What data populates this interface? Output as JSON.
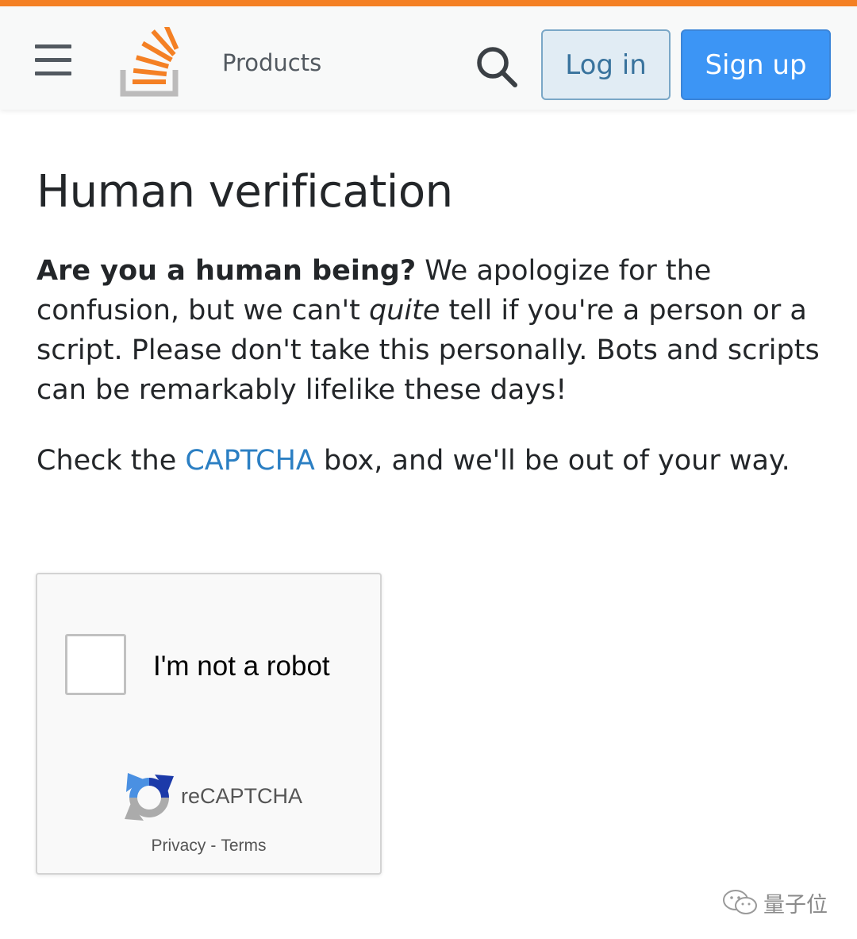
{
  "colors": {
    "accent": "#f48024",
    "login_bg": "#e1ecf4",
    "signup_bg": "#3c95f5",
    "link": "#2b7fc3"
  },
  "header": {
    "menu_icon": "hamburger-menu-icon",
    "logo": "stack-overflow-logo",
    "products_label": "Products",
    "search_icon": "search-icon",
    "login_label": "Log in",
    "signup_label": "Sign up"
  },
  "main": {
    "title": "Human verification",
    "intro_bold": "Are you a human being?",
    "intro_text_1": " We apologize for the confusion, but we can't ",
    "intro_italic": "quite",
    "intro_text_2": " tell if you're a person or a script. Please don't take this personally. Bots and scripts can be remarkably lifelike these days!",
    "check_text_1": "Check the ",
    "check_link": "CAPTCHA",
    "check_text_2": " box, and we'll be out of your way."
  },
  "recaptcha": {
    "checkbox_label": "I'm not a robot",
    "brand": "reCAPTCHA",
    "privacy_label": "Privacy",
    "separator": "-",
    "terms_label": "Terms"
  },
  "watermark": {
    "icon": "wechat-icon",
    "text": "量子位"
  }
}
